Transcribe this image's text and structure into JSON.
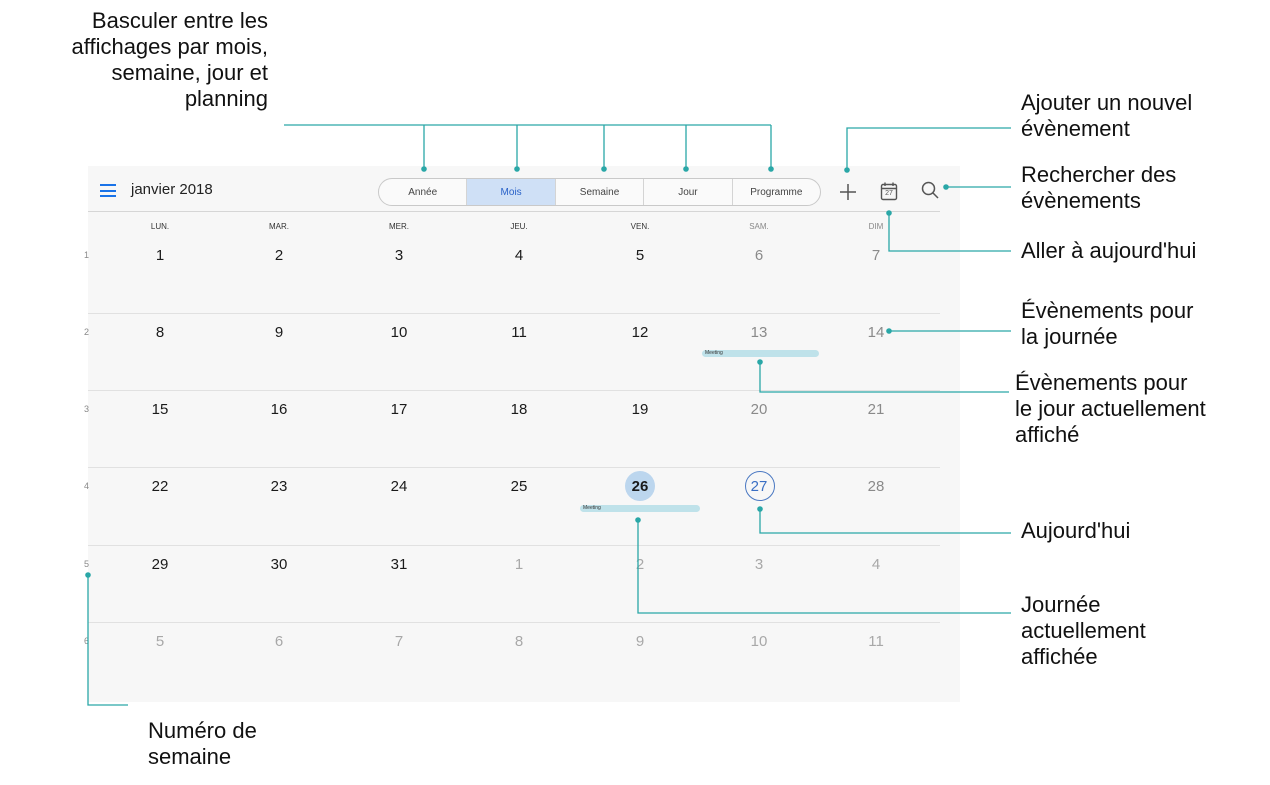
{
  "annotations": {
    "views": [
      "Basculer entre les",
      "affichages par mois,",
      "semaine, jour et",
      "planning"
    ],
    "add_event": [
      "Ajouter un nouvel",
      "évènement"
    ],
    "search": [
      "Rechercher des",
      "évènements"
    ],
    "go_today": "Aller à aujourd'hui",
    "day_events": [
      "Évènements pour",
      "la journée"
    ],
    "displayed_day_events": [
      "Évènements pour",
      "le jour actuellement",
      "affiché"
    ],
    "today": "Aujourd'hui",
    "displayed_day": [
      "Journée",
      "actuellement",
      "affichée"
    ],
    "week_number": [
      "Numéro de",
      "semaine"
    ]
  },
  "calendar": {
    "title": "janvier 2018",
    "views": [
      "Année",
      "Mois",
      "Semaine",
      "Jour",
      "Programme"
    ],
    "active_view": "Mois",
    "toolbar": {
      "add_icon": "plus-icon",
      "today_icon_day": "27",
      "search_icon": "search-icon"
    },
    "weekdays": [
      "LUN.",
      "MAR.",
      "MER.",
      "JEU.",
      "VEN.",
      "SAM.",
      "DIM"
    ],
    "weeks": [
      {
        "num": "1",
        "days": [
          "1",
          "2",
          "3",
          "4",
          "5",
          "6",
          "7"
        ]
      },
      {
        "num": "2",
        "days": [
          "8",
          "9",
          "10",
          "11",
          "12",
          "13",
          "14"
        ]
      },
      {
        "num": "3",
        "days": [
          "15",
          "16",
          "17",
          "18",
          "19",
          "20",
          "21"
        ]
      },
      {
        "num": "4",
        "days": [
          "22",
          "23",
          "24",
          "25",
          "26",
          "27",
          "28"
        ]
      },
      {
        "num": "5",
        "days": [
          "29",
          "30",
          "31",
          "1",
          "2",
          "3",
          "4"
        ]
      },
      {
        "num": "6",
        "days": [
          "5",
          "6",
          "7",
          "8",
          "9",
          "10",
          "11"
        ]
      }
    ],
    "events": [
      {
        "label": "Meeting",
        "date": "13"
      },
      {
        "label": "Meeting",
        "date": "26"
      }
    ],
    "today": "27",
    "selected_day": "26",
    "colors": {
      "accent": "#1a73e8",
      "callout": "#2aa7a7",
      "selected": "#bcd6ee",
      "event": "#bfe2ea"
    }
  }
}
